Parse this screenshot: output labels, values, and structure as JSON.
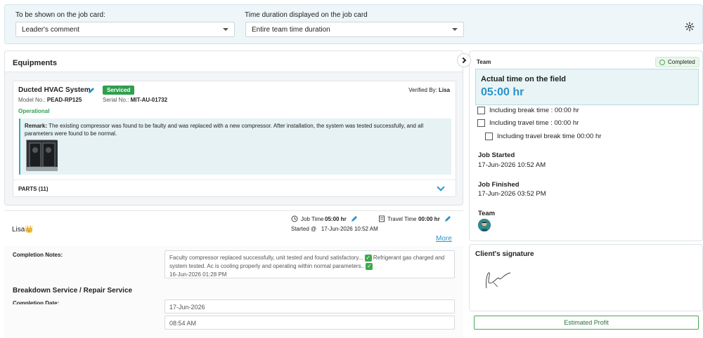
{
  "topbar": {
    "shown_label": "To be shown on the job card:",
    "shown_value": "Leader's comment",
    "duration_label": "Time duration displayed on the job card",
    "duration_value": "Entire team time duration"
  },
  "equipments": {
    "title": "Equipments",
    "card": {
      "name": "Ducted HVAC System",
      "badge": "Serviced",
      "verified_label": "Verified By:",
      "verified_by": "Lisa",
      "model_label": "Model No.:",
      "model_value": "PEAD-RP125",
      "serial_label": "Serial No.:",
      "serial_value": "MIT-AU-01732",
      "status": "Operational",
      "remark_label": "Remark:",
      "remark_text": "The existing compressor was found to be faulty and was replaced with a new compressor. After installation, the system was tested successfully, and all parameters were found to be normal.",
      "parts_label": "PARTS (11)"
    }
  },
  "lisa": {
    "name": "Lisa",
    "crown": "👑",
    "job_time_label": "Job Time",
    "job_time_value": "05:00 hr",
    "travel_time_label": "Travel Time",
    "travel_time_value": "00:00 hr",
    "started_label": "Started @",
    "started_value": "17-Jun-2026 10:52 AM",
    "more_link": "More",
    "completion_notes_label": "Completion Notes:",
    "notes_part1": "Faculty compressor replaced successfully, unit tested and found satisfactory...",
    "notes_part2": "Refrigerant gas charged and system tested. Ac is cooling properly and operating within normal parameters..",
    "notes_date": "16-Jun-2026 01:28 PM",
    "section_title": "Breakdown Service / Repair Service",
    "completion_date_label": "Completion Date:",
    "completion_date_value": "17-Jun-2026",
    "completion_time_value": "08:54 AM"
  },
  "team_panel": {
    "title": "Team",
    "status": "Completed",
    "actual_label": "Actual time on the field",
    "actual_value": "05:00 hr",
    "break_time": "Including break time : 00:00 hr",
    "travel_time": "Including travel time : 00:00 hr",
    "travel_break_time": "Including travel break time 00:00 hr",
    "job_started_label": "Job Started",
    "job_started_value": "17-Jun-2026 10:52 AM",
    "job_finished_label": "Job Finished",
    "job_finished_value": "17-Jun-2026 03:52 PM",
    "team_label": "Team"
  },
  "signature": {
    "title": "Client's signature"
  },
  "estimated_profit": "Estimated Profit",
  "colors": {
    "accent": "#2a93c9",
    "success": "#2e9e4f"
  }
}
